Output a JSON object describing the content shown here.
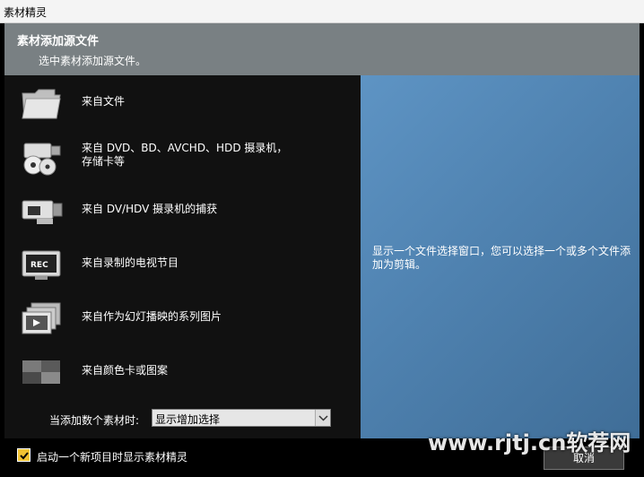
{
  "window": {
    "title": "素材精灵"
  },
  "header": {
    "title": "素材添加源文件",
    "subtitle": "选中素材添加源文件。"
  },
  "sources": [
    {
      "label": "来自文件",
      "icon": "folder-icon"
    },
    {
      "label": "来自 DVD、BD、AVCHD、HDD 摄录机，\n存储卡等",
      "icon": "camcorder-disc-icon"
    },
    {
      "label": "来自 DV/HDV 摄录机的捕获",
      "icon": "dv-camera-icon"
    },
    {
      "label": "来自录制的电视节目",
      "icon": "tv-rec-icon"
    },
    {
      "label": "来自作为幻灯播映的系列图片",
      "icon": "slideshow-images-icon"
    },
    {
      "label": "来自颜色卡或图案",
      "icon": "color-card-icon"
    }
  ],
  "options": {
    "add_multiple_label": "当添加数个素材时:",
    "add_multiple_value": "显示增加选择"
  },
  "description": "显示一个文件选择窗口，您可以选择一个或多个文件添加为剪辑。",
  "footer": {
    "show_wizard_label": "启动一个新项目时显示素材精灵",
    "show_wizard_checked": true,
    "cancel_label": "取消"
  },
  "watermark": "www.rjtj.cn软荐网",
  "colors": {
    "header_bg": "#798083",
    "description_bg": "#4f82b0",
    "checkbox": "#f1c232"
  }
}
